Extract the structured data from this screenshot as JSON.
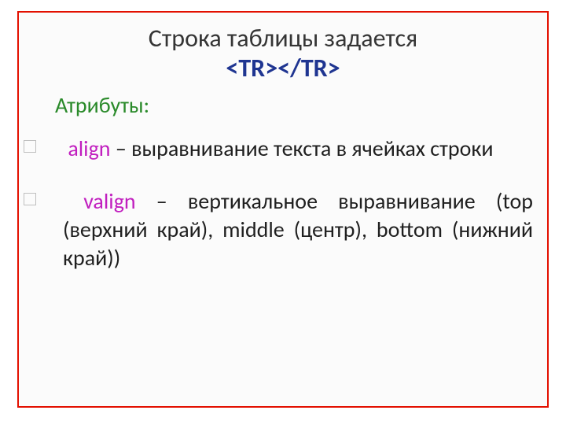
{
  "title": {
    "line1": "Строка таблицы задается",
    "tag": "<TR></TR>"
  },
  "subheading": "Атрибуты:",
  "attributes": [
    {
      "name": "align",
      "separator": " – ",
      "desc": "выравнивание текста в ячейках строки"
    },
    {
      "name": "valign",
      "separator": " – ",
      "desc": "вертикальное выравнивание (top (верхний край), middle (центр), bottom (нижний край))"
    }
  ]
}
